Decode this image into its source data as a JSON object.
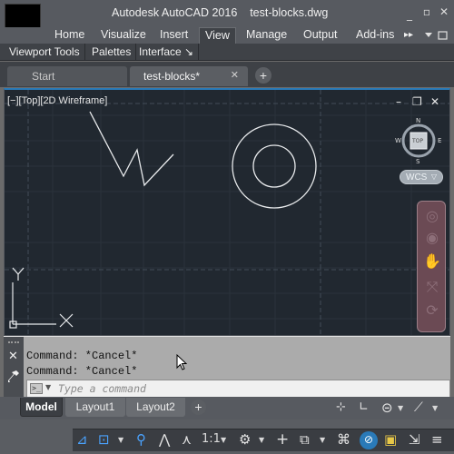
{
  "window": {
    "app_name": "Autodesk AutoCAD 2016",
    "file_name": "test-blocks.dwg",
    "minimize": "_",
    "restore": "▫",
    "close": "✕"
  },
  "ribbon": {
    "tabs": [
      {
        "label": "Home"
      },
      {
        "label": "Visualize"
      },
      {
        "label": "Insert"
      },
      {
        "label": "View",
        "active": true
      },
      {
        "label": "Manage"
      },
      {
        "label": "Output"
      },
      {
        "label": "Add-ins"
      }
    ],
    "overflow": "▸▸"
  },
  "panels": [
    {
      "label": "Viewport Tools"
    },
    {
      "label": "Palettes"
    },
    {
      "label": "Interface ↘"
    }
  ],
  "file_tabs": {
    "start_label": "Start",
    "current_label": "test-blocks*",
    "close_glyph": "✕",
    "new_glyph": "+"
  },
  "viewport": {
    "label": "[−][Top][2D Wireframe]",
    "controls": {
      "minimize": "–",
      "maximize": "❐",
      "close": "✕"
    },
    "viewcube": {
      "face": "TOP",
      "n": "N",
      "s": "S",
      "e": "E",
      "w": "W"
    },
    "wcs_label": "WCS",
    "ucs_y": "Y",
    "ucs_x": "X",
    "colors": {
      "background": "#212830",
      "grid_major": "#404a55",
      "grid_minor": "#2a323b",
      "geometry": "#e8eaec"
    }
  },
  "command": {
    "history": [
      "Command: *Cancel*",
      "Command: *Cancel*"
    ],
    "placeholder": "Type a command",
    "value": ""
  },
  "layout_tabs": [
    {
      "label": "Model",
      "active": true
    },
    {
      "label": "Layout1"
    },
    {
      "label": "Layout2"
    }
  ],
  "status": {
    "scale_label": "1:1",
    "accent": "#2a7ab8"
  }
}
